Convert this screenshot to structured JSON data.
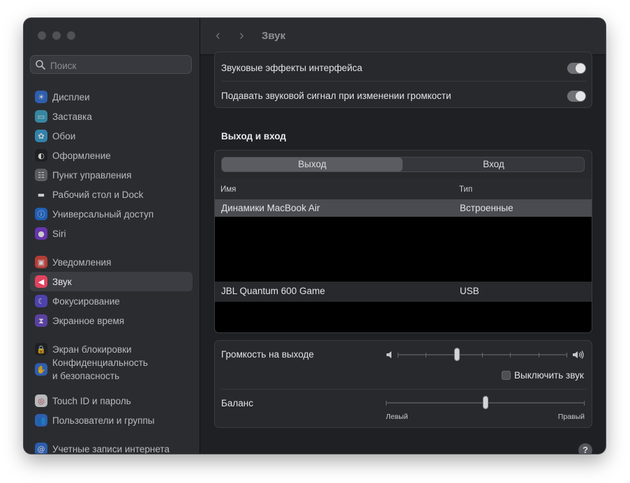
{
  "sidebar": {
    "search_placeholder": "Поиск",
    "items": [
      {
        "label": "Дисплеи",
        "icon": "display-icon",
        "color": "#2f6fd8",
        "glyph": "☀"
      },
      {
        "label": "Заставка",
        "icon": "screensaver-icon",
        "color": "#3aa6c9",
        "glyph": "▭"
      },
      {
        "label": "Обои",
        "icon": "wallpaper-icon",
        "color": "#35a0d6",
        "glyph": "✿"
      },
      {
        "label": "Оформление",
        "icon": "appearance-icon",
        "color": "#1c1c1e",
        "glyph": "◐"
      },
      {
        "label": "Пункт управления",
        "icon": "control-center-icon",
        "color": "#6b6c71",
        "glyph": "☷"
      },
      {
        "label": "Рабочий стол и Dock",
        "icon": "desktop-dock-icon",
        "color": "#2c2c30",
        "glyph": "▬"
      },
      {
        "label": "Универсальный доступ",
        "icon": "accessibility-icon",
        "color": "#1e6fe0",
        "glyph": "ⓘ"
      },
      {
        "label": "Siri",
        "icon": "siri-icon",
        "color": "#7a3ad6",
        "glyph": "●"
      },
      {
        "label": "Уведомления",
        "icon": "notifications-icon",
        "color": "#e0443a",
        "glyph": "▣"
      },
      {
        "label": "Звук",
        "icon": "sound-icon",
        "color": "#e0435f",
        "glyph": "◀"
      },
      {
        "label": "Фокусирование",
        "icon": "focus-icon",
        "color": "#5a4ad6",
        "glyph": "☾"
      },
      {
        "label": "Экранное время",
        "icon": "screen-time-icon",
        "color": "#6a48c8",
        "glyph": "⧗"
      },
      {
        "label": "Экран блокировки",
        "icon": "lock-screen-icon",
        "color": "#1c1c1e",
        "glyph": "🔒"
      },
      {
        "label": "Конфиденциальность\nи безопасность",
        "icon": "privacy-hand-icon",
        "color": "#2f6fd8",
        "glyph": "✋"
      },
      {
        "label": "Touch ID и пароль",
        "icon": "touch-id-icon",
        "color": "#e8e8ea",
        "glyph": "◎"
      },
      {
        "label": "Пользователи и группы",
        "icon": "users-icon",
        "color": "#2f6fd8",
        "glyph": "👥"
      },
      {
        "label": "Учетные записи интернета",
        "icon": "internet-accounts-icon",
        "color": "#2f6fd8",
        "glyph": "@"
      }
    ]
  },
  "header": {
    "title": "Звук",
    "back": "‹",
    "forward": "›"
  },
  "alerts": {
    "interface_effects_label": "Звуковые эффекты интерфейса",
    "interface_effects_on": true,
    "volume_feedback_label": "Подавать звуковой сигнал при изменении громкости",
    "volume_feedback_on": true
  },
  "io": {
    "section_title": "Выход и вход",
    "tabs": [
      "Выход",
      "Вход"
    ],
    "active_tab": "Выход",
    "columns": {
      "name": "Имя",
      "type": "Тип"
    },
    "devices": [
      {
        "name": "Динамики MacBook Air",
        "type": "Встроенные",
        "selected": true
      },
      {
        "name": "JBL Quantum 600 Game",
        "type": "USB",
        "selected": false
      }
    ]
  },
  "output": {
    "volume_label": "Громкость на выходе",
    "volume_fraction": 0.35,
    "mute_label": "Выключить звук",
    "muted": false,
    "balance_label": "Баланс",
    "balance_fraction": 0.5,
    "balance_left": "Левый",
    "balance_right": "Правый"
  },
  "help": "?"
}
